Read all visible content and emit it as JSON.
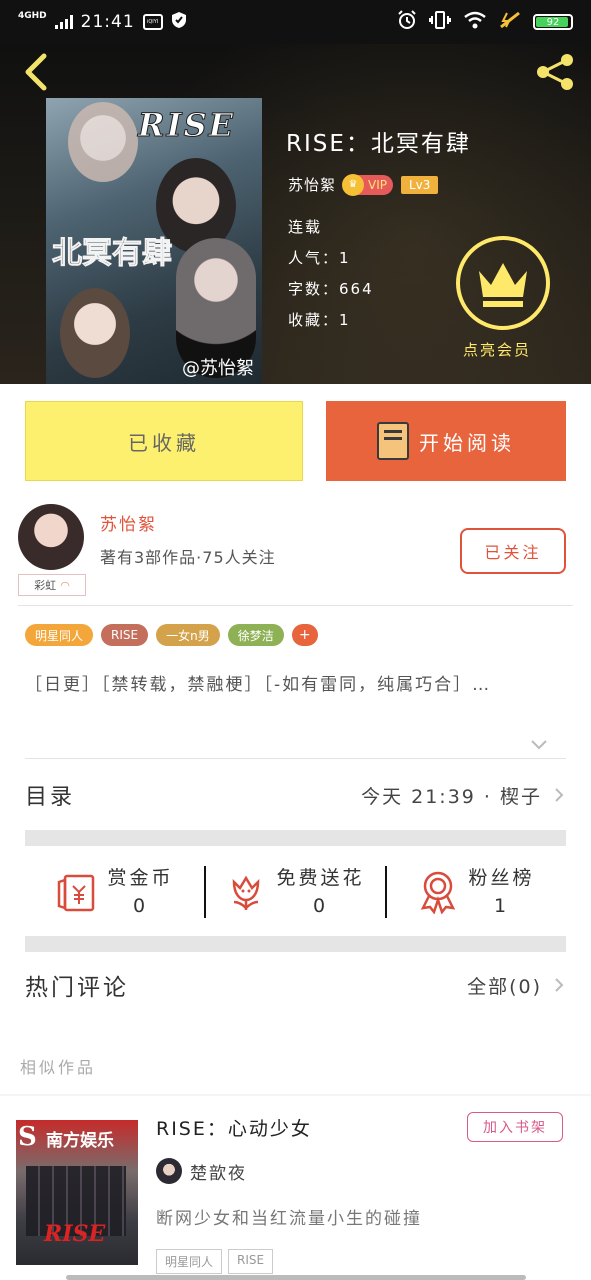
{
  "status_bar": {
    "network": "4GHD",
    "time": "21:41",
    "app_icon": "iQIYI",
    "battery": "92"
  },
  "header": {
    "book_title": "RISE：北冥有肆",
    "cover": {
      "title": "RISE",
      "subtitle": "北冥有肆",
      "signature": "@苏怡絮"
    },
    "author": "苏怡絮",
    "vip": "VIP",
    "level": "Lv3",
    "meta": [
      "连载",
      "人气：1",
      "字数：664",
      "收藏：1"
    ],
    "member_label": "点亮会员"
  },
  "actions": {
    "favorited": "已收藏",
    "start_reading": "开始阅读"
  },
  "author_box": {
    "name": "苏怡絮",
    "info": "著有3部作品·75人关注",
    "badge": "彩虹",
    "follow": "已关注"
  },
  "tags": [
    {
      "label": "明星同人",
      "color": "#f3a73a"
    },
    {
      "label": "RISE",
      "color": "#c46e5c"
    },
    {
      "label": "一女n男",
      "color": "#d4a24a"
    },
    {
      "label": "徐梦洁",
      "color": "#8fb155"
    }
  ],
  "tag_add": "+",
  "description": "［日更］［禁转载，禁融梗］［-如有雷同，纯属巧合］…",
  "toc": {
    "label": "目录",
    "value": "今天 21:39 · 楔子"
  },
  "stats": [
    {
      "label": "赏金币",
      "value": "0",
      "icon": "red-envelope-icon"
    },
    {
      "label": "免费送花",
      "value": "0",
      "icon": "flower-icon"
    },
    {
      "label": "粉丝榜",
      "value": "1",
      "icon": "ribbon-medal-icon"
    }
  ],
  "comments": {
    "label": "热门评论",
    "value": "全部(0)"
  },
  "similar": {
    "section_label": "相似作品",
    "title": "RISE：心动少女",
    "add_shelf": "加入书架",
    "author": "楚歆夜",
    "description": "断网少女和当红流量小生的碰撞",
    "tags": [
      "明星同人",
      "RISE"
    ],
    "cover": {
      "logo": "S",
      "logo_text": "南方娱乐",
      "title": "RISE"
    }
  },
  "colors": {
    "accent": "#e8643d",
    "favorite": "#fdf06e",
    "member": "#ffe96b"
  }
}
